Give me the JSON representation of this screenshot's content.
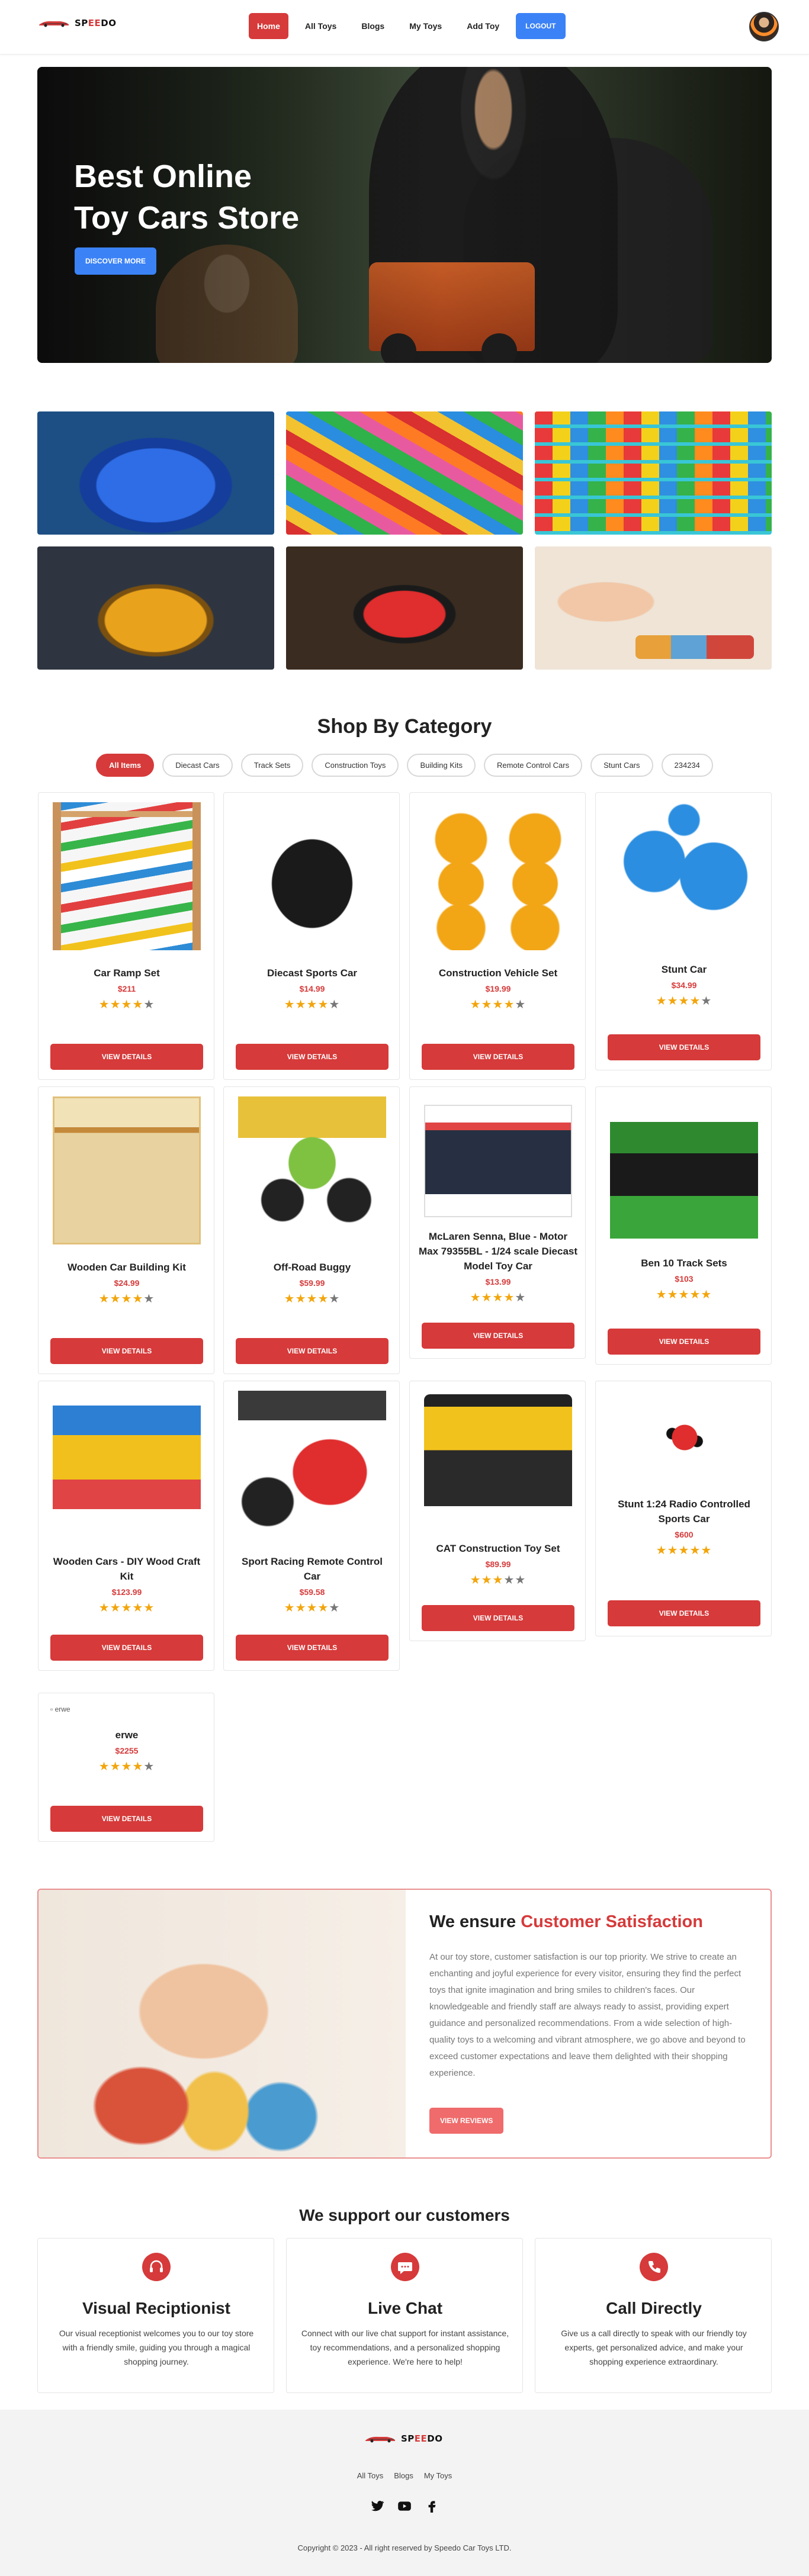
{
  "brand": {
    "name_prefix": "SP",
    "name_accent": "EE",
    "name_suffix": "DO",
    "accent_color": "#d63a3a"
  },
  "nav": {
    "links": [
      "Home",
      "All Toys",
      "Blogs",
      "My Toys",
      "Add Toy"
    ],
    "logout": "LOGOUT"
  },
  "hero": {
    "title_line1": "Best Online",
    "title_line2": "Toy Cars Store",
    "button": "DISCOVER MORE"
  },
  "category": {
    "title": "Shop By Category",
    "tabs": [
      "All Items",
      "Diecast Cars",
      "Track Sets",
      "Construction Toys",
      "Building Kits",
      "Remote Control Cars",
      "Stunt Cars",
      "234234"
    ],
    "active_tab": "All Items"
  },
  "products": [
    {
      "name": "Car Ramp Set",
      "price": "$211",
      "rating": 4,
      "button": "VIEW DETAILS",
      "image": "im-ramp"
    },
    {
      "name": "Diecast Sports Car",
      "price": "$14.99",
      "rating": 4,
      "button": "VIEW DETAILS",
      "image": "im-sport"
    },
    {
      "name": "Construction Vehicle Set",
      "price": "$19.99",
      "rating": 4,
      "button": "VIEW DETAILS",
      "image": "im-construct"
    },
    {
      "name": "Stunt Car",
      "price": "$34.99",
      "rating": 4,
      "button": "VIEW DETAILS",
      "image": "im-stunt"
    },
    {
      "name": "Wooden Car Building Kit",
      "price": "$24.99",
      "rating": 4,
      "button": "VIEW DETAILS",
      "image": "im-wood"
    },
    {
      "name": "Off-Road Buggy",
      "price": "$59.99",
      "rating": 4,
      "button": "VIEW DETAILS",
      "image": "im-buggy"
    },
    {
      "name": "McLaren Senna, Blue - Motor Max 79355BL - 1/24 scale Diecast Model Toy Car",
      "price": "$13.99",
      "rating": 4,
      "button": "VIEW DETAILS",
      "image": "im-mclaren"
    },
    {
      "name": "Ben 10 Track Sets",
      "price": "$103",
      "rating": 5,
      "button": "VIEW DETAILS",
      "image": "im-ben10"
    },
    {
      "name": "Wooden Cars - DIY Wood Craft Kit",
      "price": "$123.99",
      "rating": 5,
      "button": "VIEW DETAILS",
      "image": "im-woodencars"
    },
    {
      "name": "Sport Racing Remote Control Car",
      "price": "$59.58",
      "rating": 4,
      "button": "VIEW DETAILS",
      "image": "im-rc"
    },
    {
      "name": "CAT Construction Toy Set",
      "price": "$89.99",
      "rating": 3,
      "button": "VIEW DETAILS",
      "image": "im-cat"
    },
    {
      "name": "Stunt 1:24 Radio Controlled Sports Car",
      "price": "$600",
      "rating": 5,
      "button": "VIEW DETAILS",
      "image": "im-stunt2"
    },
    {
      "name": "erwe",
      "price": "$2255",
      "rating": 4,
      "button": "VIEW DETAILS",
      "image": "broken",
      "alt": "erwe"
    }
  ],
  "satisfaction": {
    "title_plain": "We ensure ",
    "title_accent": "Customer Satisfaction",
    "text": "At our toy store, customer satisfaction is our top priority. We strive to create an enchanting and joyful experience for every visitor, ensuring they find the perfect toys that ignite imagination and bring smiles to children's faces. Our knowledgeable and friendly staff are always ready to assist, providing expert guidance and personalized recommendations. From a wide selection of high-quality toys to a welcoming and vibrant atmosphere, we go above and beyond to exceed customer expectations and leave them delighted with their shopping experience.",
    "button": "VIEW REVIEWS"
  },
  "support": {
    "title": "We support our customers",
    "cards": [
      {
        "icon": "headset-icon",
        "title": "Visual Reciptionist",
        "text": "Our visual receptionist welcomes you to our toy store with a friendly smile, guiding you through a magical shopping journey."
      },
      {
        "icon": "chat-icon",
        "title": "Live Chat",
        "text": "Connect with our live chat support for instant assistance, toy recommendations, and a personalized shopping experience. We're here to help!"
      },
      {
        "icon": "phone-icon",
        "title": "Call Directly",
        "text": "Give us a call directly to speak with our friendly toy experts, get personalized advice, and make your shopping experience extraordinary."
      }
    ]
  },
  "footer": {
    "links": [
      "All Toys",
      "Blogs",
      "My Toys"
    ],
    "social": [
      "twitter-icon",
      "youtube-icon",
      "facebook-icon"
    ],
    "copyright": "Copyright © 2023 - All right reserved by Speedo Car Toys LTD."
  }
}
